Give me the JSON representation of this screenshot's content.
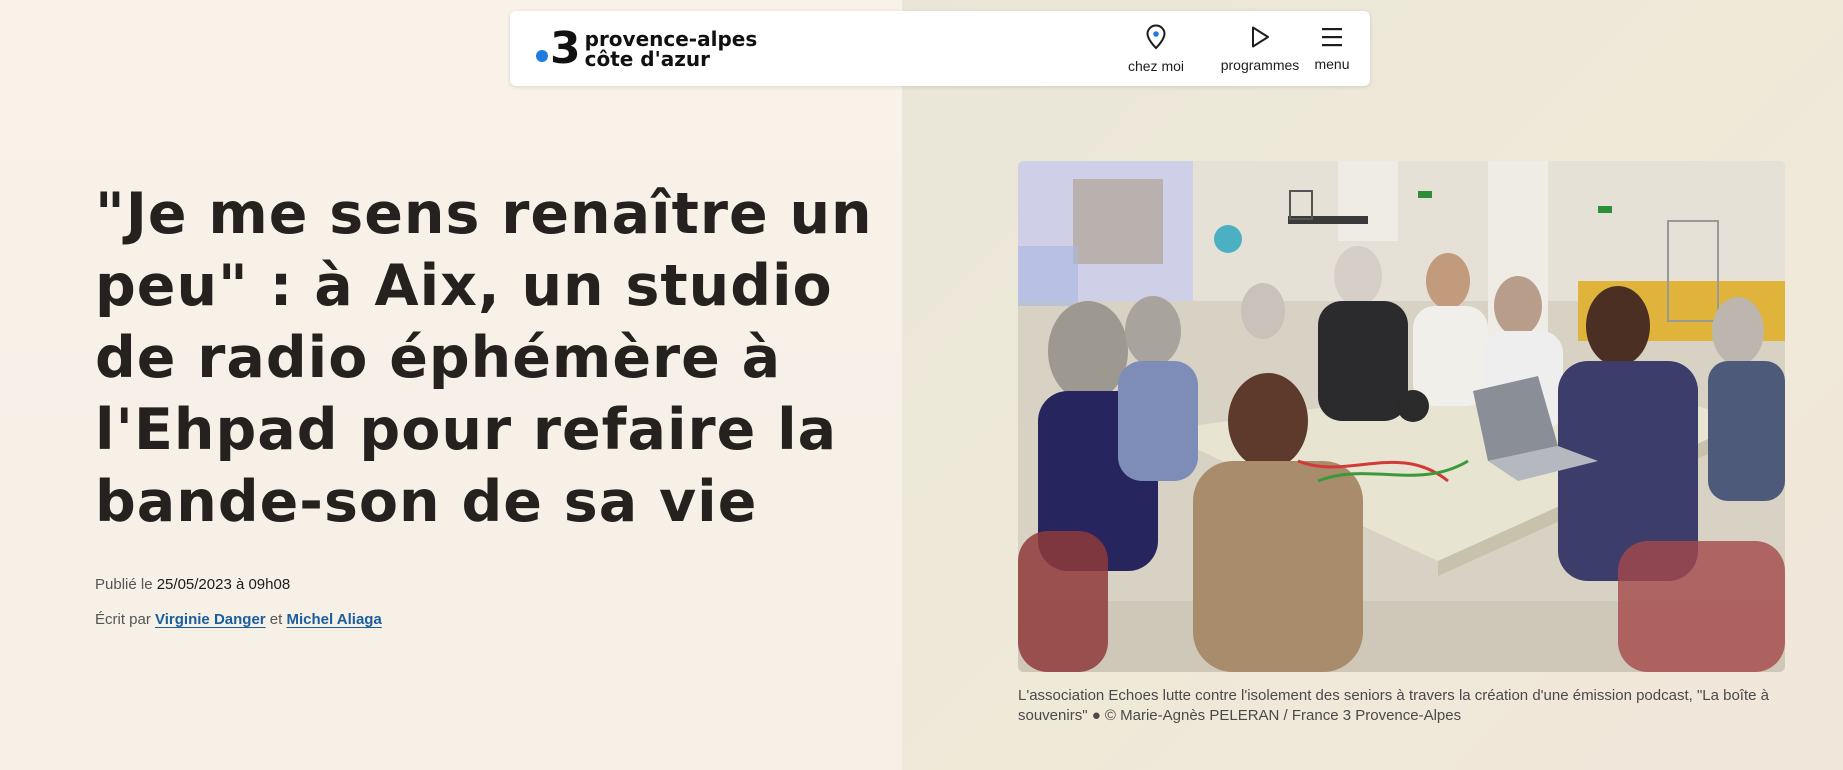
{
  "header": {
    "logo": {
      "number": "3",
      "line1": "provence-alpes",
      "line2": "côte d'azur",
      "dot_color": "#1f7bde"
    },
    "nav": [
      {
        "label": "chez moi",
        "icon": "location-pin-icon"
      },
      {
        "label": "programmes",
        "icon": "play-icon"
      },
      {
        "label": "menu",
        "icon": "hamburger-menu-icon"
      }
    ]
  },
  "article": {
    "title": "\"Je me sens renaître un peu\" : à Aix, un studio de radio éphémère à l'Ehpad pour refaire la bande-son de sa vie",
    "published_prefix": "Publié le",
    "published_value": "25/05/2023 à 09h08",
    "authors_prefix": "Écrit par",
    "author1": "Virginie Danger",
    "authors_sep": "et",
    "author2": "Michel Aliaga"
  },
  "photo": {
    "caption": "L'association Echoes lutte contre l'isolement des seniors à travers la création d'une émission podcast, \"La boîte à souvenirs\" ● © Marie-Agnès PELERAN / France 3 Provence-Alpes"
  },
  "colors": {
    "link": "#1a5e9e",
    "accent": "#1f7bde",
    "text": "#24211e"
  }
}
